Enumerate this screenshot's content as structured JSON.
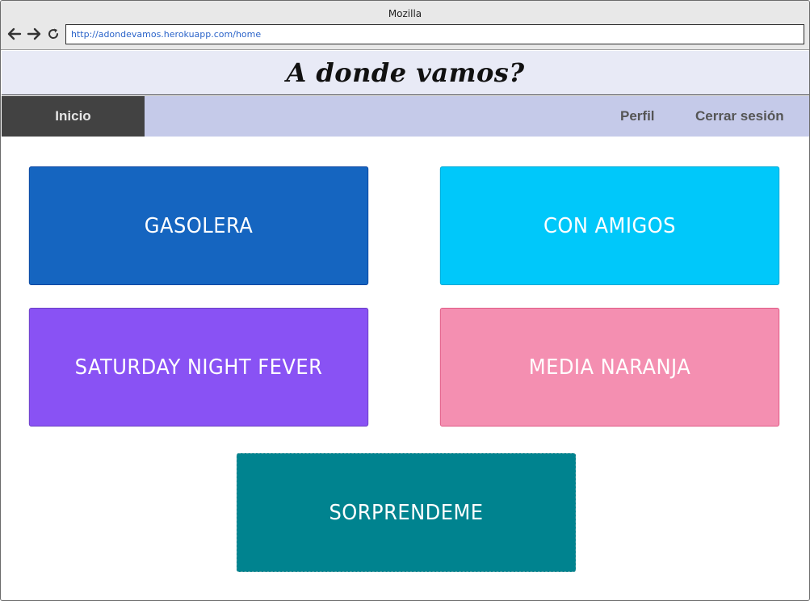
{
  "browser": {
    "window_title": "Mozilla",
    "url": "http://adondevamos.herokuapp.com/home",
    "icons": [
      "arrow-left-icon",
      "arrow-right-icon",
      "reload-icon"
    ]
  },
  "header": {
    "title": "A donde vamos?"
  },
  "navbar": {
    "home_label": "Inicio",
    "profile_label": "Perfil",
    "logout_label": "Cerrar sesión"
  },
  "cards": [
    {
      "label": "GASOLERA",
      "color": "#1565c0"
    },
    {
      "label": "CON AMIGOS",
      "color": "#00c8fa"
    },
    {
      "label": "SATURDAY NIGHT FEVER",
      "color": "#8952f4"
    },
    {
      "label": "MEDIA NARANJA",
      "color": "#f48fb1"
    },
    {
      "label": "SORPRENDEME",
      "color": "#00838f"
    }
  ]
}
